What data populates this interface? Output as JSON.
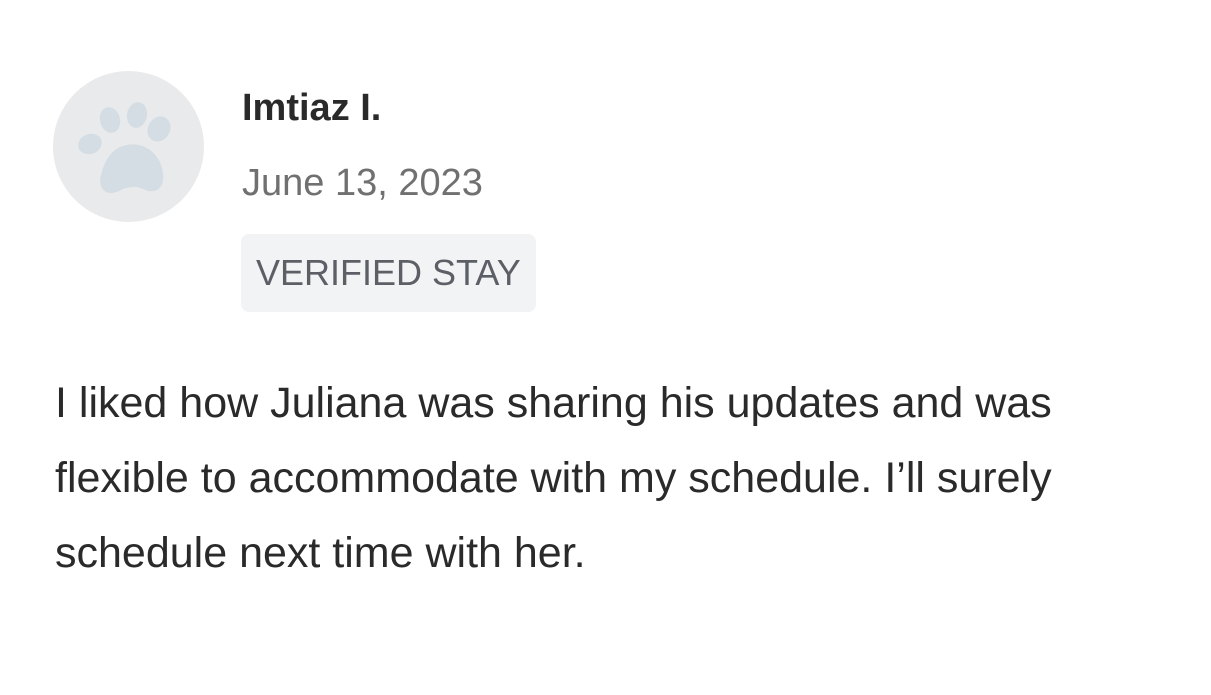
{
  "review": {
    "avatar_icon": "paw-icon",
    "reviewer_name": "Imtiaz I.",
    "date": "June 13, 2023",
    "badge_label": "VERIFIED STAY",
    "text": "I liked how Juliana was sharing his updates and was flexible to accommodate with my schedule. I’ll surely schedule next time with her."
  },
  "colors": {
    "avatar_background": "#e9eaeb",
    "avatar_icon": "#d5dde4",
    "name_text": "#2a2a2a",
    "date_text": "#707070",
    "badge_background": "#f2f3f4",
    "badge_text": "#5c6066",
    "body_text": "#2a2a2a"
  }
}
